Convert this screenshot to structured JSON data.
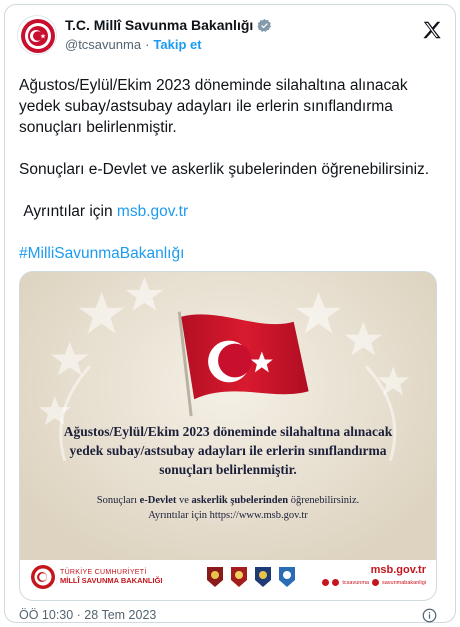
{
  "account": {
    "display_name": "T.C. Millî Savunma Bakanlığı",
    "handle": "@tcsavunma",
    "separator": "·",
    "follow_label": "Takip et"
  },
  "tweet": {
    "paragraph1": "Ağustos/Eylül/Ekim 2023 döneminde silahaltına alınacak yedek subay/astsubay adayları ile erlerin sınıflandırma sonuçları belirlenmiştir.",
    "paragraph2": "Sonuçları e-Devlet ve askerlik şubelerinden öğrenebilirsiniz.",
    "details_prefix": " Ayrıntılar için ",
    "details_link": "msb.gov.tr",
    "hashtag": "#MilliSavunmaBakanlığı"
  },
  "media": {
    "headline_line1": "Ağustos/Eylül/Ekim 2023 döneminde silahaltına alınacak",
    "headline_line2": "yedek subay/astsubay adayları ile erlerin sınıflandırma",
    "headline_line3": "sonuçları belirlenmiştir.",
    "sub_line1_a": "Sonuçları ",
    "sub_line1_b": "e-Devlet",
    "sub_line1_c": " ve ",
    "sub_line1_d": "askerlik şubelerinden",
    "sub_line1_e": " öğrenebilirsiniz.",
    "sub_line2": "Ayrıntılar için https://www.msb.gov.tr",
    "footer_org_line1": "TÜRKİYE CUMHURİYETİ",
    "footer_org_line2": "MİLLÎ SAVUNMA BAKANLIĞI",
    "footer_site": "msb.gov.tr",
    "footer_social_handle": "tcsavunma",
    "footer_social_handle2": "savunmabakanligi"
  },
  "meta": {
    "timestamp": "ÖÖ 10:30 · 28 Tem 2023"
  },
  "colors": {
    "accent": "#1d9bf0",
    "flag_red": "#c8102e",
    "ministry_red": "#c4161c"
  }
}
